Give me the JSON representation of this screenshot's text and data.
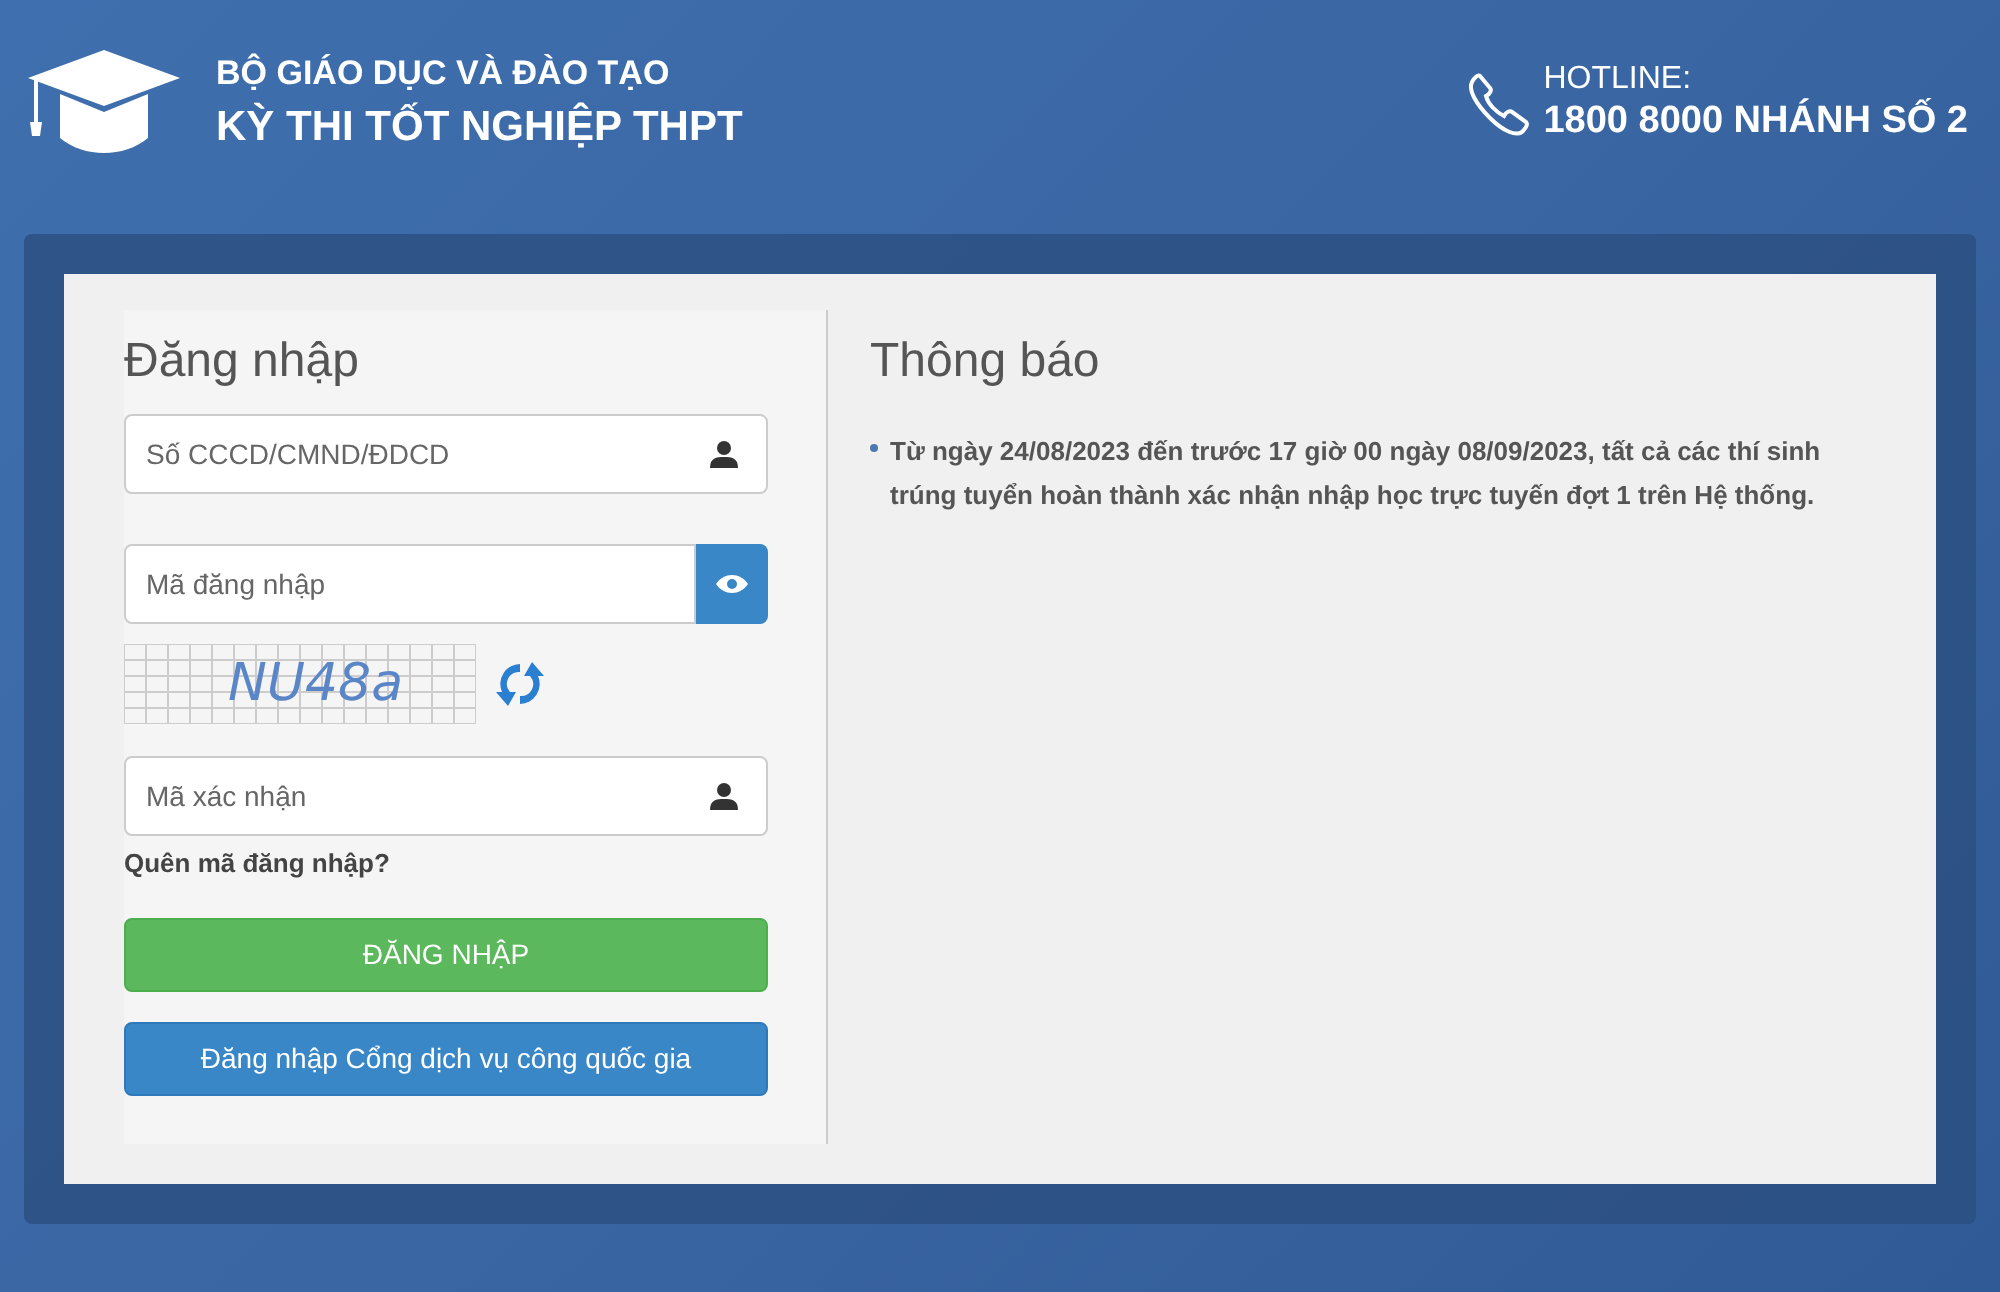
{
  "header": {
    "ministry": "BỘ GIÁO DỤC VÀ ĐÀO TẠO",
    "exam": "KỲ THI TỐT NGHIỆP THPT",
    "hotline_label": "HOTLINE:",
    "hotline_number": "1800 8000 NHÁNH SỐ 2"
  },
  "login": {
    "title": "Đăng nhập",
    "id_field": {
      "placeholder": "Số CCCD/CMND/ĐDCD"
    },
    "password_field": {
      "placeholder": "Mã đăng nhập"
    },
    "captcha": "NU48a",
    "captcha_field": {
      "placeholder": "Mã xác nhận"
    },
    "forgot_link": "Quên mã đăng nhập?",
    "buttons": [
      {
        "kind": "primary",
        "label": "ĐĂNG NHẬP"
      },
      {
        "kind": "secondary",
        "label": "Đăng nhập Cổng dịch vụ công quốc gia"
      }
    ]
  },
  "notices": {
    "title": "Thông báo",
    "items": [
      "Từ ngày 24/08/2023 đến trước 17 giờ 00 ngày 08/09/2023, tất cả các thí sinh trúng tuyển hoàn thành xác nhận nhập học trực tuyến đợt 1 trên Hệ thống."
    ]
  }
}
